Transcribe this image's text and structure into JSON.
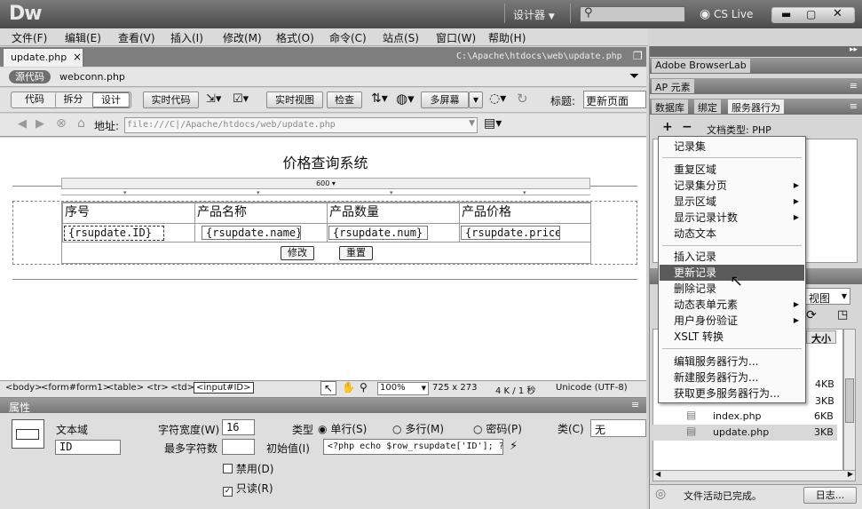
{
  "app": {
    "logo": "Dw",
    "workspace": "设计器",
    "search_placeholder": "",
    "cslive": "CS Live"
  },
  "menu": [
    "文件(F)",
    "编辑(E)",
    "查看(V)",
    "插入(I)",
    "修改(M)",
    "格式(O)",
    "命令(C)",
    "站点(S)",
    "窗口(W)",
    "帮助(H)"
  ],
  "tab": {
    "label": "update.php",
    "close": "×",
    "path": "C:\\Apache\\htdocs\\web\\update.php"
  },
  "related": {
    "source": "源代码",
    "file": "webconn.php"
  },
  "doc_toolbar": {
    "code": "代码",
    "split": "拆分",
    "design": "设计",
    "livecode": "实时代码",
    "liveview": "实时视图",
    "inspect": "检查",
    "multiscreen": "多屏幕",
    "title_label": "标题:",
    "title_value": "更新页面"
  },
  "address": {
    "label": "地址:",
    "value": "file:///C|/Apache/htdocs/web/update.php"
  },
  "page": {
    "heading": "价格查询系统",
    "table_width": "600",
    "headers": [
      "序号",
      "产品名称",
      "产品数量",
      "产品价格"
    ],
    "fields": [
      "{rsupdate.ID}",
      "{rsupdate.name}",
      "{rsupdate.num}",
      "{rsupdate.price"
    ],
    "modify_btn": "修改",
    "reset_btn": "重置"
  },
  "status": {
    "tags": [
      "<body>",
      "<form#form1>",
      "<table>",
      "<tr>",
      "<td>",
      "<input#ID>"
    ],
    "zoom": "100%",
    "size": "725 x 273",
    "download": "4 K / 1 秒",
    "encoding": "Unicode (UTF-8)"
  },
  "properties": {
    "title": "属性",
    "type_label": "文本域",
    "name_value": "ID",
    "char_width_label": "字符宽度(W)",
    "char_width_value": "16",
    "max_chars_label": "最多字符数",
    "max_chars_value": "",
    "kind_label": "类型",
    "single_line": "单行(S)",
    "multi_line": "多行(M)",
    "password": "密码(P)",
    "initial_label": "初始值(I)",
    "initial_value": "<?php echo $row_rsupdate['ID']; ?",
    "class_label": "类(C)",
    "class_value": "无",
    "disabled_label": "禁用(D)",
    "readonly_label": "只读(R)"
  },
  "panels": {
    "browserlab": "Adobe BrowserLab",
    "ap": "AP 元素",
    "tabs": [
      "数据库",
      "绑定",
      "服务器行为"
    ],
    "plus": "+",
    "minus": "−",
    "doctype": "文档类型: PHP",
    "view_label": "视图",
    "size_header": "大小",
    "sizes": [
      "4KB",
      "3KB"
    ],
    "files": [
      {
        "name": "index.php",
        "size": "6KB"
      },
      {
        "name": "update.php",
        "size": "3KB"
      }
    ],
    "log_status": "文件活动已完成。",
    "log_button": "日志..."
  },
  "context_menu": [
    {
      "label": "记录集",
      "sub": false
    },
    {
      "label": "重复区域",
      "sub": false
    },
    {
      "label": "记录集分页",
      "sub": true
    },
    {
      "label": "显示区域",
      "sub": true
    },
    {
      "label": "显示记录计数",
      "sub": true
    },
    {
      "label": "动态文本",
      "sub": false
    },
    {
      "label": "插入记录",
      "sub": false
    },
    {
      "label": "更新记录",
      "sub": false
    },
    {
      "label": "删除记录",
      "sub": false
    },
    {
      "label": "动态表单元素",
      "sub": true
    },
    {
      "label": "用户身份验证",
      "sub": true
    },
    {
      "label": "XSLT 转换",
      "sub": false
    },
    {
      "label": "编辑服务器行为...",
      "sub": false
    },
    {
      "label": "新建服务器行为...",
      "sub": false
    },
    {
      "label": "获取更多服务器行为...",
      "sub": false
    }
  ]
}
